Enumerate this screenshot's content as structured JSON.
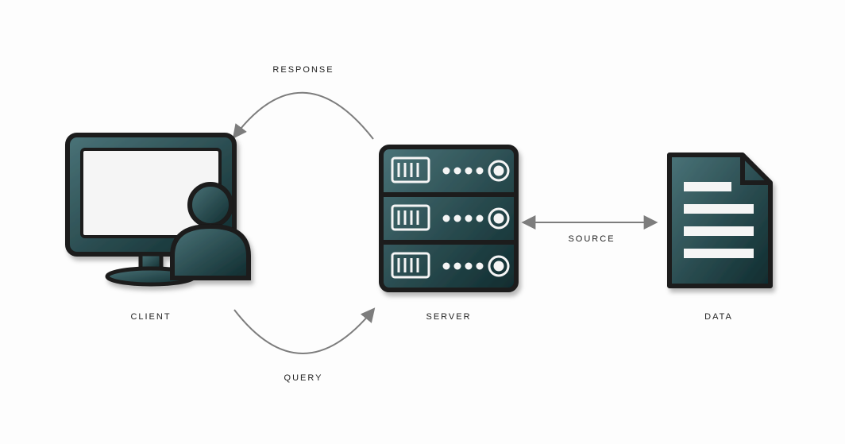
{
  "nodes": {
    "client": {
      "label": "CLIENT"
    },
    "server": {
      "label": "SERVER"
    },
    "data": {
      "label": "DATA"
    }
  },
  "arrows": {
    "response": {
      "label": "RESPONSE"
    },
    "query": {
      "label": "QUERY"
    },
    "source": {
      "label": "SOURCE"
    }
  },
  "palette": {
    "grad_light": "#4a7378",
    "grad_dark": "#0f2b2e",
    "stroke": "#1a1a1a",
    "arrow": "#7d7d7d",
    "screen": "#f5f5f5"
  }
}
